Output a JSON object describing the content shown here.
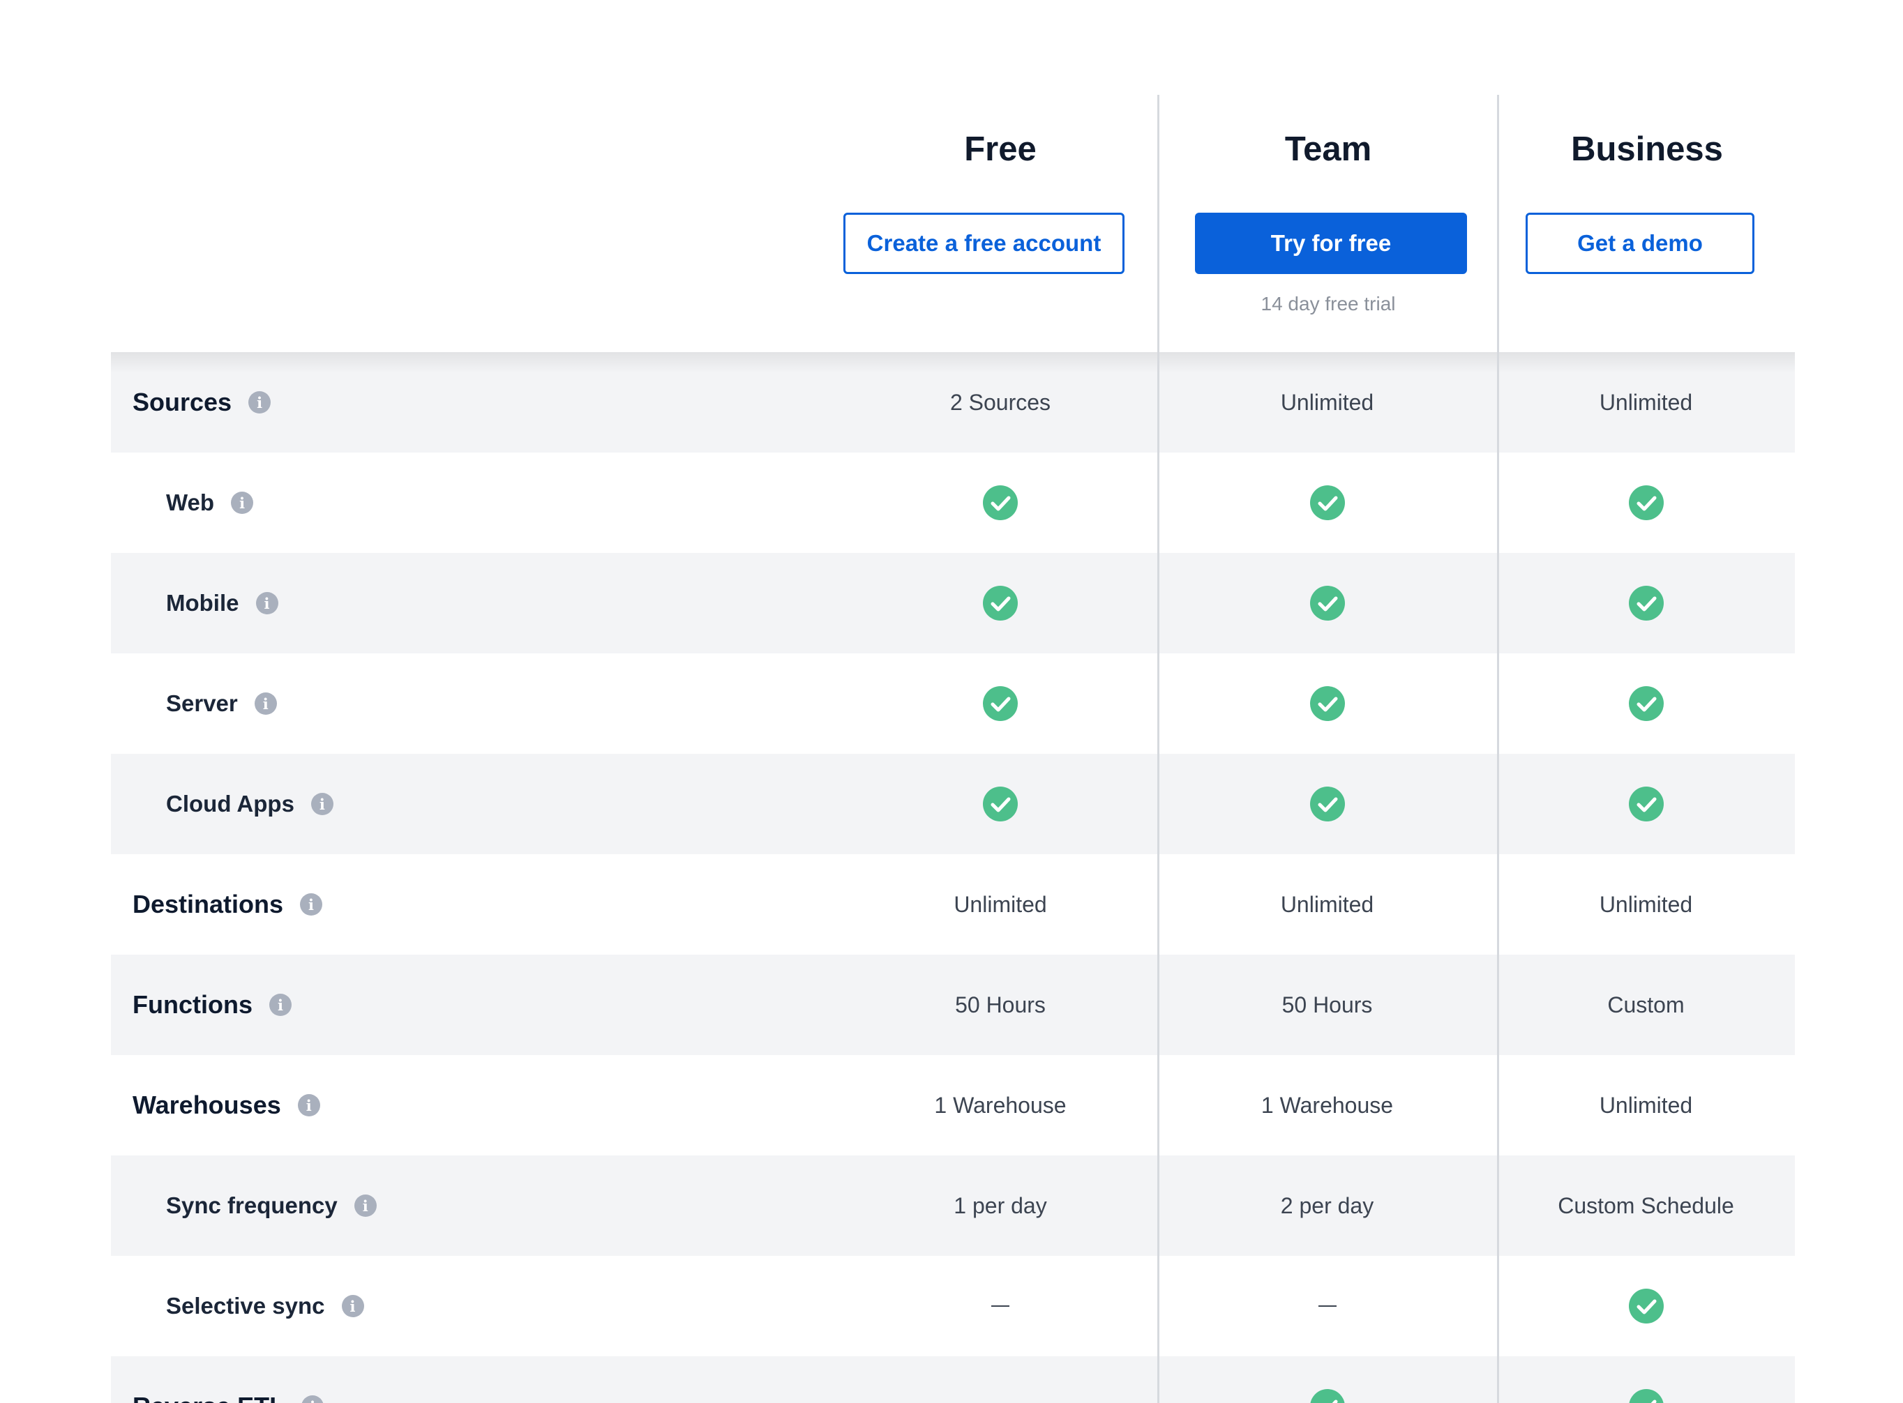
{
  "plans": [
    {
      "name": "Free",
      "cta": "Create a free account",
      "note": ""
    },
    {
      "name": "Team",
      "cta": "Try for free",
      "note": "14 day free trial"
    },
    {
      "name": "Business",
      "cta": "Get a demo",
      "note": ""
    }
  ],
  "colors": {
    "accent": "#0a61da",
    "check": "#4dbf8b",
    "shaded_row": "#f3f4f6",
    "divider": "#d6d9de",
    "info_icon": "#a9b0bd"
  },
  "rows": [
    {
      "label": "Sources",
      "level": "top",
      "values": [
        "2 Sources",
        "Unlimited",
        "Unlimited"
      ]
    },
    {
      "label": "Web",
      "level": "sub",
      "values": [
        "check",
        "check",
        "check"
      ]
    },
    {
      "label": "Mobile",
      "level": "sub",
      "values": [
        "check",
        "check",
        "check"
      ]
    },
    {
      "label": "Server",
      "level": "sub",
      "values": [
        "check",
        "check",
        "check"
      ]
    },
    {
      "label": "Cloud Apps",
      "level": "sub",
      "values": [
        "check",
        "check",
        "check"
      ]
    },
    {
      "label": "Destinations",
      "level": "top",
      "values": [
        "Unlimited",
        "Unlimited",
        "Unlimited"
      ]
    },
    {
      "label": "Functions",
      "level": "top",
      "values": [
        "50 Hours",
        "50 Hours",
        "Custom"
      ]
    },
    {
      "label": "Warehouses",
      "level": "top",
      "values": [
        "1 Warehouse",
        "1 Warehouse",
        "Unlimited"
      ]
    },
    {
      "label": "Sync frequency",
      "level": "sub",
      "values": [
        "1 per day",
        "2 per day",
        "Custom Schedule"
      ]
    },
    {
      "label": "Selective sync",
      "level": "sub",
      "values": [
        "dash",
        "dash",
        "check"
      ]
    },
    {
      "label": "Reverse ETL",
      "level": "top",
      "values": [
        "",
        "check",
        "check"
      ]
    }
  ],
  "icons": {
    "info": "info-icon",
    "included": "check-circle-icon",
    "not_included": "dash-icon"
  }
}
